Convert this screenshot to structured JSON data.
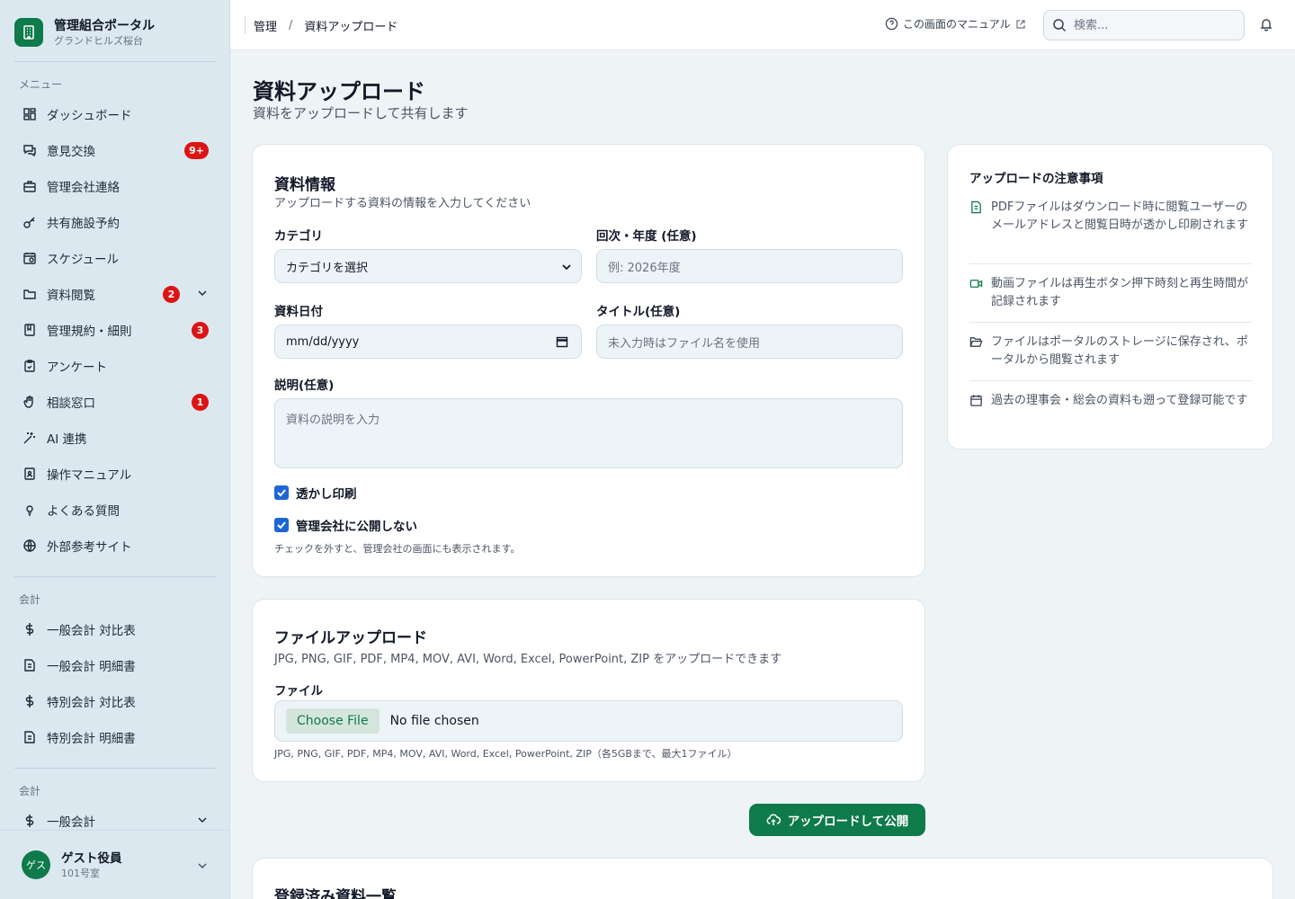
{
  "brand": {
    "title": "管理組合ポータル",
    "subtitle": "グランドヒルズ桜台"
  },
  "sidebar": {
    "section_menu": "メニュー",
    "items": [
      {
        "label": "ダッシュボード",
        "icon": "dashboard-icon"
      },
      {
        "label": "意見交換",
        "icon": "chat-icon",
        "badge": "9+"
      },
      {
        "label": "管理会社連絡",
        "icon": "briefcase-icon"
      },
      {
        "label": "共有施設予約",
        "icon": "key-icon"
      },
      {
        "label": "スケジュール",
        "icon": "calendar-icon"
      },
      {
        "label": "資料閲覧",
        "icon": "folder-icon",
        "badge": "2"
      },
      {
        "label": "管理規約・細則",
        "icon": "book-icon",
        "badge": "3"
      },
      {
        "label": "アンケート",
        "icon": "clipboard-icon"
      },
      {
        "label": "相談窓口",
        "icon": "hand-icon",
        "badge": "1"
      },
      {
        "label": "AI 連携",
        "icon": "sparkle-icon"
      },
      {
        "label": "操作マニュアル",
        "icon": "manual-icon"
      },
      {
        "label": "よくある質問",
        "icon": "lightbulb-icon"
      },
      {
        "label": "外部参考サイト",
        "icon": "globe-icon"
      }
    ],
    "section_accounting": "会計",
    "accounting_items": [
      {
        "label": "一般会計 対比表",
        "icon": "dollar-icon"
      },
      {
        "label": "一般会計 明細書",
        "icon": "document-icon"
      },
      {
        "label": "特別会計 対比表",
        "icon": "dollar-icon"
      },
      {
        "label": "特別会計 明細書",
        "icon": "document-icon"
      }
    ],
    "section_accounting2": "会計",
    "accounting2_items": [
      {
        "label": "一般会計",
        "icon": "dollar-icon"
      }
    ],
    "user": {
      "avatar": "ゲス",
      "name": "ゲスト役員",
      "room": "101号室"
    }
  },
  "header": {
    "breadcrumb": [
      "管理",
      "資料アップロード"
    ],
    "breadcrumb_sep": "/",
    "manual_link": "この画面のマニュアル",
    "search_placeholder": "検索..."
  },
  "page": {
    "title": "資料アップロード",
    "subtitle": "資料をアップロードして共有します"
  },
  "info_card": {
    "title": "資料情報",
    "subtitle": "アップロードする資料の情報を入力してください",
    "category_label": "カテゴリ",
    "category_value": "カテゴリを選択",
    "term_label": "回次・年度 (任意)",
    "term_placeholder": "例: 2026年度",
    "date_label": "資料日付",
    "date_placeholder": "mm/dd/yyyy",
    "title_label": "タイトル(任意)",
    "title_placeholder": "未入力時はファイル名を使用",
    "desc_label": "説明(任意)",
    "desc_placeholder": "資料の説明を入力",
    "watermark_label": "透かし印刷",
    "watermark_checked": true,
    "private_label": "管理会社に公開しない",
    "private_checked": true,
    "private_hint": "チェックを外すと、管理会社の画面にも表示されます。"
  },
  "file_card": {
    "title": "ファイルアップロード",
    "subtitle": "JPG, PNG, GIF, PDF, MP4, MOV, AVI, Word, Excel, PowerPoint, ZIP をアップロードできます",
    "file_label": "ファイル",
    "choose_button": "Choose File",
    "file_status": "No file chosen",
    "hint": "JPG, PNG, GIF, PDF, MP4, MOV, AVI, Word, Excel, PowerPoint, ZIP（各5GBまで、最大1ファイル）"
  },
  "submit_button": "アップロードして公開",
  "notes": {
    "title": "アップロードの注意事項",
    "items": [
      {
        "icon": "file-text-icon",
        "text": "PDFファイルはダウンロード時に閲覧ユーザーのメールアドレスと閲覧日時が透かし印刷されます"
      },
      {
        "icon": "video-icon",
        "text": "動画ファイルは再生ボタン押下時刻と再生時間が記録されます"
      },
      {
        "icon": "folder-open-icon",
        "text": "ファイルはポータルのストレージに保存され、ポータルから閲覧されます"
      },
      {
        "icon": "calendar-icon",
        "text": "過去の理事会・総会の資料も遡って登録可能です"
      }
    ]
  },
  "list_card": {
    "title": "登録済み資料一覧"
  },
  "colors": {
    "brand": "#0f7a4a",
    "badge": "#dc1414",
    "checkbox": "#1e66d4",
    "sidebar_bg": "#dce8f0"
  }
}
